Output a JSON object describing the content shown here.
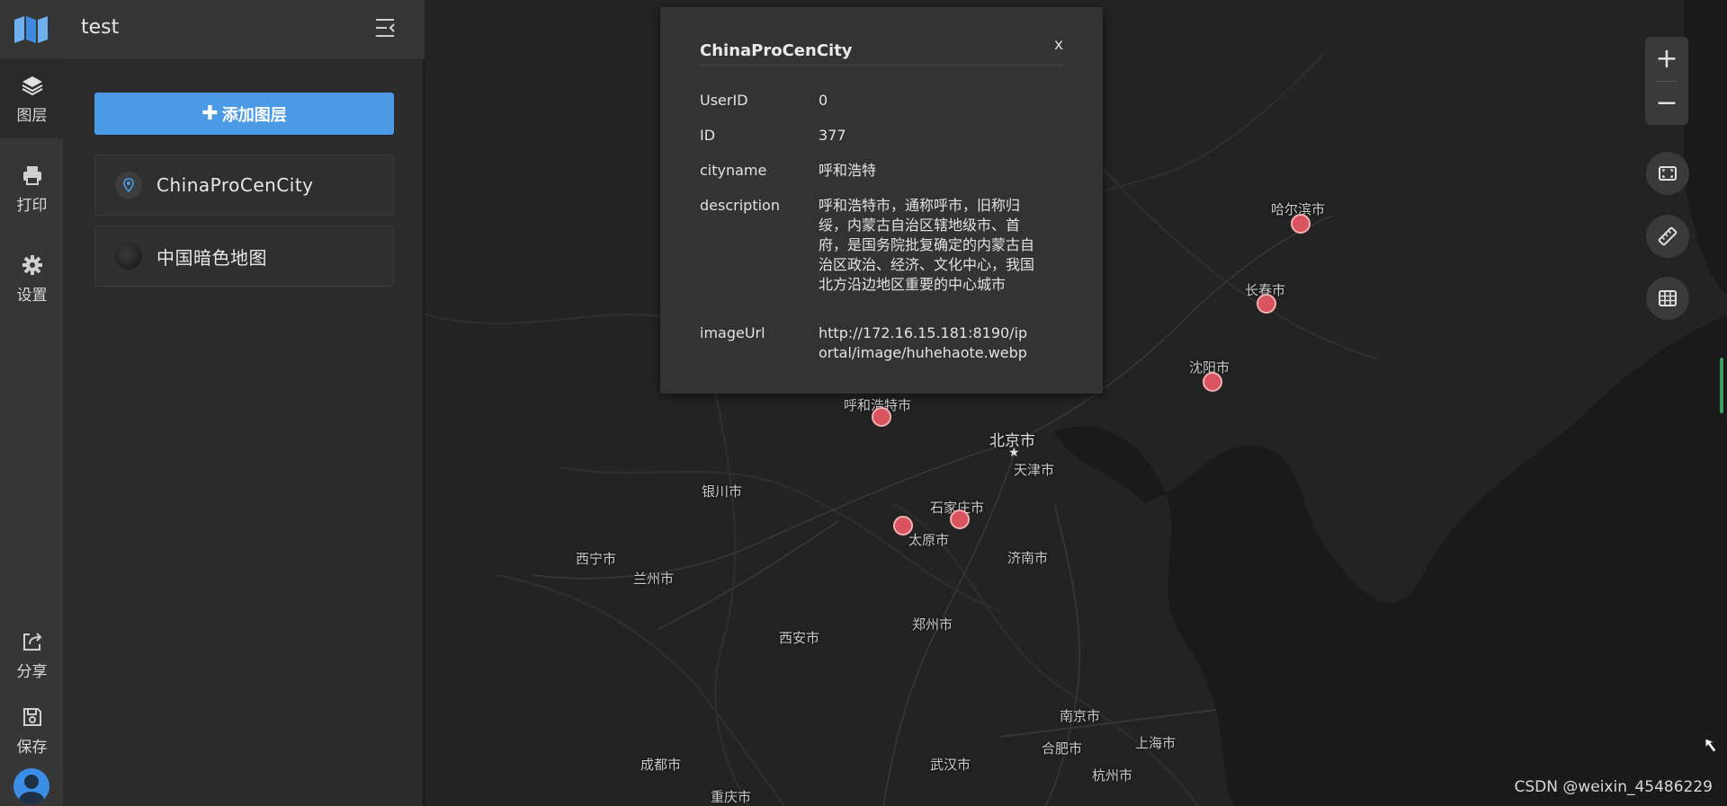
{
  "app": {
    "title": "test"
  },
  "rail": {
    "items": [
      {
        "label": "图层",
        "icon": "layers-icon",
        "active": true
      },
      {
        "label": "打印",
        "icon": "printer-icon"
      },
      {
        "label": "设置",
        "icon": "gear-icon"
      },
      {
        "label": "分享",
        "icon": "share-icon"
      },
      {
        "label": "保存",
        "icon": "save-icon"
      }
    ]
  },
  "panel": {
    "add_button": "添加图层",
    "layers": [
      {
        "name": "ChinaProCenCity",
        "icon": "map-pin-icon"
      },
      {
        "name": "中国暗色地图",
        "icon": "dark-map-thumbnail"
      }
    ]
  },
  "popup": {
    "title": "ChinaProCenCity",
    "close_label": "x",
    "rows": [
      {
        "key": "UserID",
        "value": "0"
      },
      {
        "key": "ID",
        "value": "377"
      },
      {
        "key": "cityname",
        "value": "呼和浩特"
      },
      {
        "key": "description",
        "value": "呼和浩特市，通称呼市，旧称归绥，内蒙古自治区辖地级市、首府，是国务院批复确定的内蒙古自治区政治、经济、文化中心，我国北方沿边地区重要的中心城市"
      },
      {
        "key": "imageUrl",
        "value": "http://172.16.15.181:8190/iportal/image/huhehaote.webp"
      }
    ]
  },
  "map": {
    "labels": [
      "哈尔滨市",
      "长春市",
      "沈阳市",
      "呼和浩特市",
      "北京市",
      "天津市",
      "银川市",
      "石家庄市",
      "太原市",
      "济南市",
      "西宁市",
      "兰州市",
      "西安市",
      "郑州市",
      "南京市",
      "上海市",
      "合肥市",
      "杭州市",
      "成都市",
      "武汉市",
      "重庆市"
    ],
    "marker_color": "#d9545e"
  },
  "controls": {
    "zoom_in": "+",
    "zoom_out": "−"
  },
  "watermark": "CSDN @weixin_45486229"
}
